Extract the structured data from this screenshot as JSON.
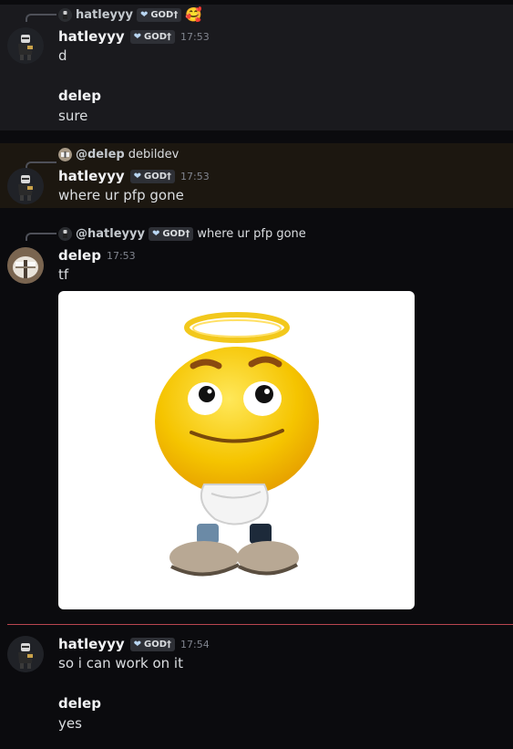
{
  "messages": [
    {
      "reply": {
        "name": "hatleyyy",
        "tag": "GOD†",
        "reaction": "🥰"
      },
      "author": "hatleyyy",
      "tag": "GOD†",
      "time": "17:53",
      "text": "d",
      "followup_author": "delep",
      "followup_text": "sure"
    },
    {
      "reply": {
        "name": "@delep",
        "text": "debildev"
      },
      "author": "hatleyyy",
      "tag": "GOD†",
      "time": "17:53",
      "text": "where ur pfp gone"
    },
    {
      "reply": {
        "name": "@hatleyyy",
        "tag": "GOD†",
        "text": "where ur pfp gone"
      },
      "author": "delep",
      "time": "17:53",
      "text": "tf",
      "image": "halo-smiley-emoji"
    },
    {
      "author": "hatleyyy",
      "tag": "GOD†",
      "time": "17:54",
      "text": "so i can work on it",
      "followup_author": "delep",
      "followup_text": "yes"
    }
  ],
  "colors": {
    "background": "#0b0b0e",
    "highlight": "#1a1a1e",
    "mention_highlight": "#1c1710",
    "new_divider": "#b9464f"
  },
  "icons": [
    "heart-icon",
    "avatar-hatleyyy",
    "avatar-delep"
  ]
}
